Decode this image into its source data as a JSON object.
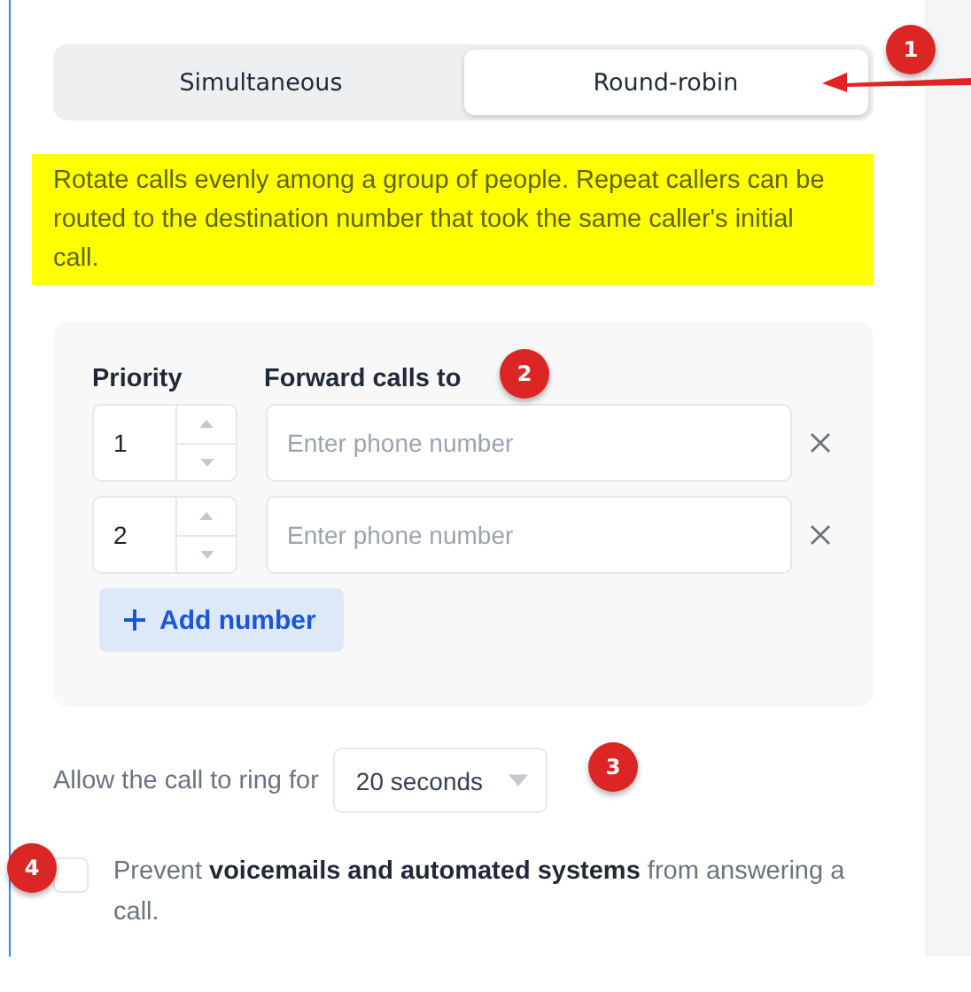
{
  "mode_tabs": [
    {
      "label": "Simultaneous",
      "selected": false
    },
    {
      "label": "Round-robin",
      "selected": true
    }
  ],
  "description": {
    "text": "Rotate calls evenly among a group of people. Repeat callers can be routed to the destination number that took the same caller's initial call.",
    "highlighted": true
  },
  "forwarding": {
    "priority_header": "Priority",
    "forward_header": "Forward calls to",
    "rows": [
      {
        "priority": "1",
        "placeholder": "Enter phone number"
      },
      {
        "priority": "2",
        "placeholder": "Enter phone number"
      }
    ],
    "add_button": "Add number"
  },
  "ring": {
    "label": "Allow the call to ring for",
    "value": "20 seconds"
  },
  "voicemail_check": {
    "checked": false,
    "text": "Prevent **voicemails and automated systems** from answering a call."
  },
  "annotations": [
    {
      "label": "1"
    },
    {
      "label": "2"
    },
    {
      "label": "3"
    },
    {
      "label": "4"
    }
  ]
}
